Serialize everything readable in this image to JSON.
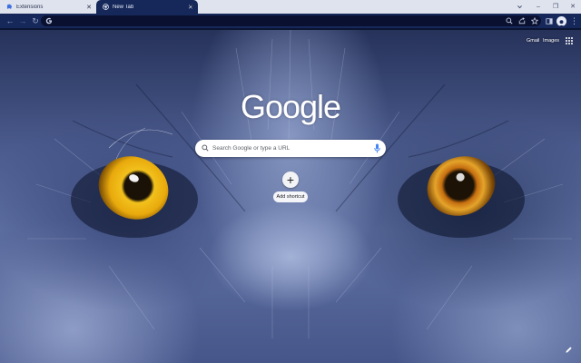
{
  "tabs": [
    {
      "label": "Extensions",
      "active": false
    },
    {
      "label": "New Tab",
      "active": true
    }
  ],
  "tabbar": {
    "new_tab_symbol": "+",
    "search_tabs_icon": "chevron-down-icon"
  },
  "window_controls": {
    "minimize": "–",
    "maximize": "❐",
    "close": "✕"
  },
  "toolbar": {
    "back_symbol": "←",
    "forward_symbol": "→",
    "reload_symbol": "↻",
    "address_value": "",
    "menu_symbol": "⋮"
  },
  "top_links": {
    "gmail": "Gmail",
    "images": "Images"
  },
  "logo": {
    "text": "Google"
  },
  "search": {
    "placeholder": "Search Google or type a URL"
  },
  "shortcut": {
    "plus": "+",
    "label": "Add shortcut"
  },
  "colors": {
    "toolbar_bg": "#16285a",
    "tabstrip_bg": "#dfe3ee",
    "omnibox_bg": "#0a1130",
    "left_eye": "#f2c11c",
    "right_eye": "#e5a42a",
    "mic_blue": "#4285f4"
  },
  "icons": [
    "puzzle-icon",
    "chrome-icon",
    "google-g-icon",
    "zoom-icon",
    "share-icon",
    "star-icon",
    "side-panel-icon",
    "profile-icon",
    "apps-grid-icon",
    "search-icon",
    "mic-icon",
    "pencil-icon"
  ]
}
